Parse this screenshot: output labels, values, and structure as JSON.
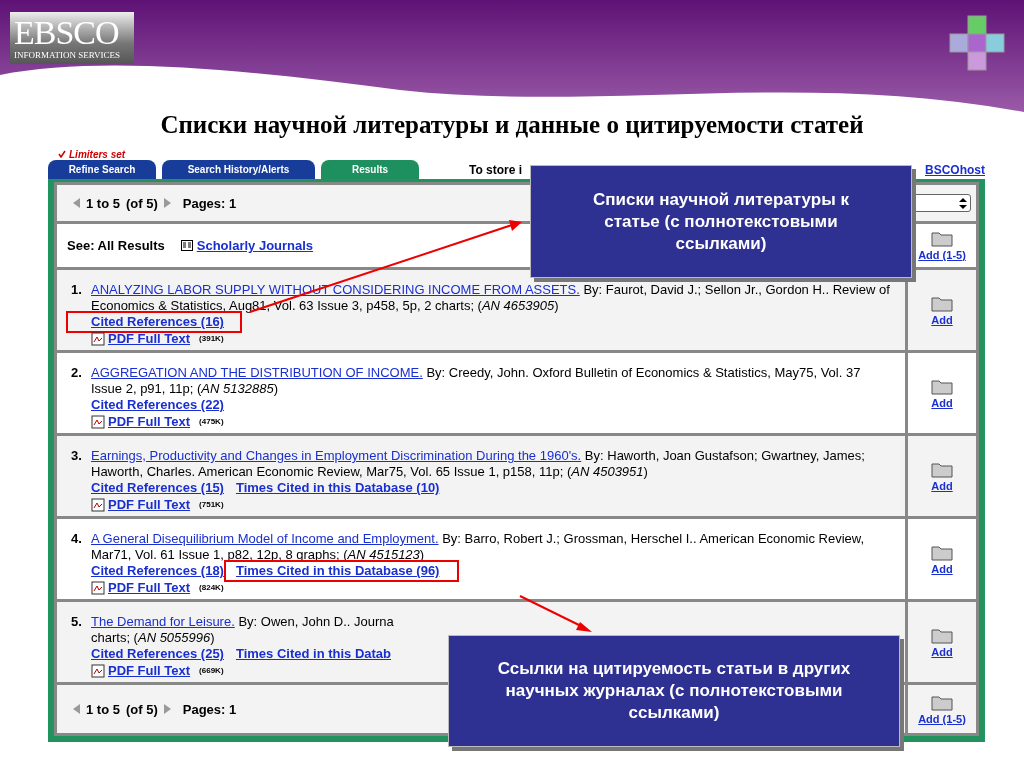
{
  "slide": {
    "title": "Списки научной литературы и данные о цитируемости статей",
    "logo_text": "EBSCO",
    "logo_subtitle": "INFORMATION SERVICES"
  },
  "limiters": "Limiters set",
  "tabs": [
    {
      "label": "Refine Search",
      "selected": false
    },
    {
      "label": "Search History/Alerts",
      "selected": false
    },
    {
      "label": "Results",
      "selected": true
    }
  ],
  "store_text": "To store i",
  "store_link": "BSCOhost",
  "pager_top": {
    "range": "1 to 5",
    "total": "(of 5)",
    "pages": "Pages: 1"
  },
  "filter": {
    "label": "See: All Results",
    "link": "Scholarly Journals"
  },
  "add_all_top": "Add (1-5)",
  "results": [
    {
      "number": "1.",
      "title": "ANALYZING LABOR SUPPLY WITHOUT CONSIDERING INCOME FROM ASSETS.",
      "citation": "By: Faurot, David J.; Sellon Jr., Gordon H.. Review of Economics & Statistics, Aug81, Vol. 63 Issue 3, p458, 5p, 2 charts; (*AN 4653905*)",
      "cited_refs": "Cited References (16)",
      "pdf": "PDF Full Text",
      "size": "(391K)",
      "add": "Add",
      "cited_refs_highlighted": true
    },
    {
      "number": "2.",
      "title": "AGGREGATION AND THE DISTRIBUTION OF INCOME.",
      "citation": "By: Creedy, John. Oxford Bulletin of Economics & Statistics, May75, Vol. 37 Issue 2, p91, 11p; (*AN 5132885*)",
      "cited_refs": "Cited References (22)",
      "pdf": "PDF Full Text",
      "size": "(475K)",
      "add": "Add",
      "cited_refs_highlighted": false
    },
    {
      "number": "3.",
      "title": "Earnings, Productivity and Changes in Employment Discrimination During the 1960's.",
      "citation": "By: Haworth, Joan Gustafson; Gwartney, James; Haworth, Charles. American Economic Review, Mar75, Vol. 65 Issue 1, p158, 11p; (*AN 4503951*)",
      "cited_refs": "Cited References (15)",
      "times_cited": "Times Cited in this Database (10)",
      "pdf": "PDF Full Text",
      "size": "(751K)",
      "add": "Add",
      "cited_refs_highlighted": false,
      "times_cited_highlighted": false
    },
    {
      "number": "4.",
      "title": "A General Disequilibrium Model of Income and Employment.",
      "citation": "By: Barro, Robert J.; Grossman, Herschel I.. American Economic Review, Mar71, Vol. 61 Issue 1, p82, 12p, 8 graphs; (*AN 4515123*)",
      "cited_refs": "Cited References (18)",
      "times_cited": "Times Cited in this Database (96)",
      "pdf": "PDF Full Text",
      "size": "(824K)",
      "add": "Add",
      "cited_refs_highlighted": false,
      "times_cited_highlighted": true
    },
    {
      "number": "5.",
      "title": "The Demand for Leisure.",
      "citation": "By: Owen, John D.. Journa",
      "citation_2": "charts; (*AN 5055996*)",
      "cited_refs": "Cited References (25)",
      "times_cited": "Times Cited in this Datab",
      "pdf": "PDF Full Text",
      "size": "(669K)",
      "add": "Add",
      "cited_refs_highlighted": false,
      "times_cited_highlighted": false
    }
  ],
  "pager_bottom": {
    "range": "1 to 5",
    "total": "(of 5)",
    "pages": "Pages: 1"
  },
  "add_all_bottom": "Add (1-5)",
  "callouts": [
    {
      "text": "Списки научной литературы к статье (с полнотекстовыми ссылками)"
    },
    {
      "text": "Ссылки на цитируемость статьи в других научных журналах (с полнотекстовыми ссылками)"
    }
  ]
}
